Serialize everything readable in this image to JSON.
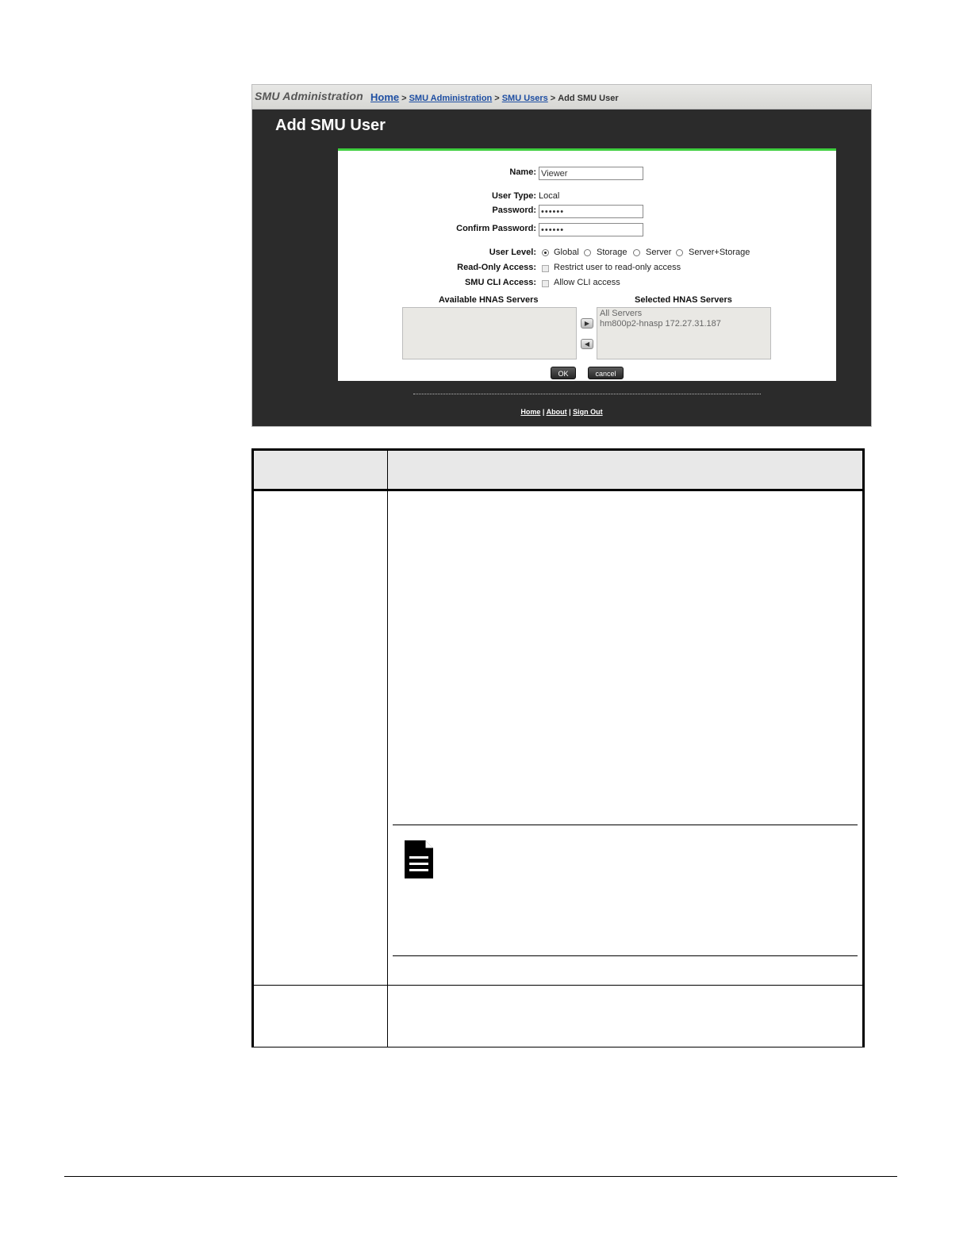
{
  "screenshot": {
    "app_title": "SMU Administration",
    "breadcrumb": {
      "home": "Home",
      "sep": ">",
      "smu_administration": "SMU Administration",
      "smu_users": "SMU Users",
      "current": "Add SMU User"
    },
    "page_title": "Add SMU User",
    "form": {
      "name_label": "Name:",
      "name_value": "Viewer",
      "user_type_label": "User Type:",
      "user_type_value": "Local",
      "password_label": "Password:",
      "password_value": "••••••",
      "confirm_password_label": "Confirm Password:",
      "confirm_password_value": "••••••",
      "user_level_label": "User Level:",
      "user_level_options": [
        "Global",
        "Storage",
        "Server",
        "Server+Storage"
      ],
      "user_level_selected": "Global",
      "read_only_label": "Read-Only Access:",
      "read_only_option": "Restrict user to read-only access",
      "cli_label": "SMU CLI Access:",
      "cli_option": "Allow CLI access",
      "available_servers_label": "Available HNAS Servers",
      "selected_servers_label": "Selected HNAS Servers",
      "available_servers": [],
      "selected_servers": [
        "All Servers",
        "hm800p2-hnasp 172.27.31.187"
      ],
      "ok_label": "OK",
      "cancel_label": "cancel"
    },
    "footer": {
      "home": "Home",
      "about": "About",
      "sign_out": "Sign Out",
      "sep": "|"
    }
  },
  "icons": {
    "note": "document-note-icon",
    "move_right": "arrow-right-icon",
    "move_left": "arrow-left-icon"
  },
  "colors": {
    "accent_green": "#3fcf3f",
    "link_blue": "#1f4fa3",
    "frame_dark": "#2b2b2b"
  }
}
